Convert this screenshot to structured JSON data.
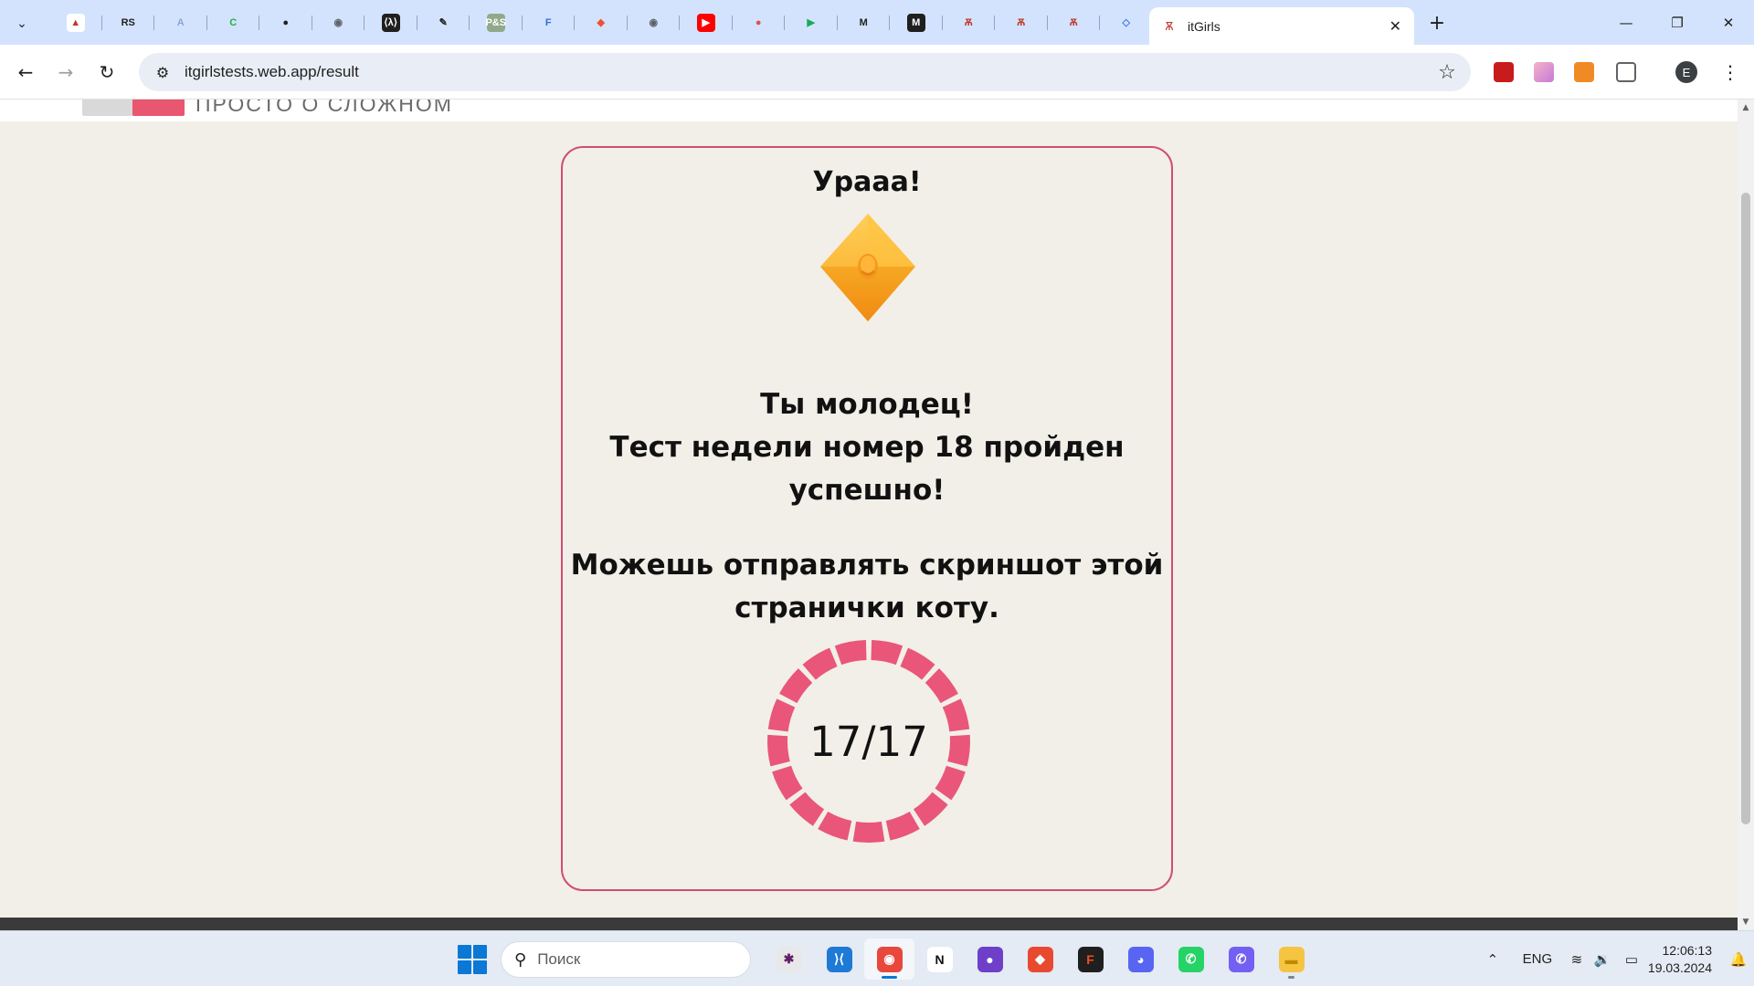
{
  "browser": {
    "tab_search_icon": "chevron-down-icon",
    "pinned_tabs": [
      {
        "icon": "pdf-reader-icon",
        "glyph": "▲",
        "bg": "#ffffff",
        "fg": "#c0392b"
      },
      {
        "icon": "rs-school-icon",
        "glyph": "RS",
        "bg": "transparent",
        "fg": "#1f1f1f"
      },
      {
        "icon": "a-letter-icon",
        "glyph": "A",
        "bg": "transparent",
        "fg": "#8aa6d6"
      },
      {
        "icon": "c-letter-icon",
        "glyph": "C",
        "bg": "transparent",
        "fg": "#1fb33a"
      },
      {
        "icon": "github-icon",
        "glyph": "●",
        "bg": "transparent",
        "fg": "#1f1f1f"
      },
      {
        "icon": "globe-icon",
        "glyph": "◉",
        "bg": "transparent",
        "fg": "#5f6368"
      },
      {
        "icon": "codewars-icon",
        "glyph": "⟨λ⟩",
        "bg": "#1f1f1f",
        "fg": "#ffffff"
      },
      {
        "icon": "pen-icon",
        "glyph": "✎",
        "bg": "transparent",
        "fg": "#1f1f1f"
      },
      {
        "icon": "pands-icon",
        "glyph": "P&S",
        "bg": "#8fa98a",
        "fg": "#ffffff"
      },
      {
        "icon": "docs-icon",
        "glyph": "F",
        "bg": "transparent",
        "fg": "#2f6fd6"
      },
      {
        "icon": "git-icon",
        "glyph": "◆",
        "bg": "transparent",
        "fg": "#f05033"
      },
      {
        "icon": "globe-icon",
        "glyph": "◉",
        "bg": "transparent",
        "fg": "#5f6368"
      },
      {
        "icon": "youtube-icon",
        "glyph": "▶",
        "bg": "#ff0000",
        "fg": "#ffffff"
      },
      {
        "icon": "pinterest-icon",
        "glyph": "●",
        "bg": "transparent",
        "fg": "#d9534f"
      },
      {
        "icon": "play-icon",
        "glyph": "▶",
        "bg": "transparent",
        "fg": "#19a95a"
      },
      {
        "icon": "mail-icon",
        "glyph": "M",
        "bg": "transparent",
        "fg": "#1f1f1f"
      },
      {
        "icon": "medium-icon",
        "glyph": "M",
        "bg": "#1f1f1f",
        "fg": "#ffffff"
      },
      {
        "icon": "itgirls-icon",
        "glyph": "Ѫ",
        "bg": "transparent",
        "fg": "#c0392b"
      },
      {
        "icon": "itgirls-icon",
        "glyph": "Ѫ",
        "bg": "transparent",
        "fg": "#c0392b"
      },
      {
        "icon": "itgirls-icon",
        "glyph": "Ѫ",
        "bg": "transparent",
        "fg": "#c0392b"
      },
      {
        "icon": "cube-icon",
        "glyph": "◇",
        "bg": "transparent",
        "fg": "#3a7bd5"
      }
    ],
    "active_tab": {
      "title": "itGirls",
      "icon": "itgirls-icon",
      "close_icon": "close-icon"
    },
    "new_tab_icon": "plus-icon",
    "window_controls": {
      "minimize": "—",
      "restore": "❐",
      "close": "✕"
    },
    "url": "itgirlstests.web.app/result",
    "avatar_letter": "E",
    "extensions": [
      {
        "icon": "acrobat-icon",
        "color": "#c81b1b"
      },
      {
        "icon": "gradient-extension-icon",
        "color": "#e68fb8"
      },
      {
        "icon": "orange-extension-icon",
        "color": "#f08a24"
      },
      {
        "icon": "puzzle-icon",
        "color": "#5f6368"
      }
    ]
  },
  "page": {
    "header_tagline": "ПРОСТО О СЛОЖНОМ",
    "card_title": "Урааа!",
    "message_line1": "Ты молодец!",
    "message_line2": "Тест недели номер 18 пройден",
    "message_line3": "успешно!",
    "screenshot_line1": "Можешь отправлять скриншот этой",
    "screenshot_line2": "странички коту.",
    "score_text": "17/17",
    "score": {
      "correct": 17,
      "total": 17
    },
    "accent_color": "#e9567a",
    "border_color": "#d14d72",
    "background_color": "#f2efe8"
  },
  "taskbar": {
    "search_placeholder": "Поиск",
    "apps": [
      {
        "name": "slack",
        "glyph": "✱",
        "bg": "#e8e8e8",
        "fg": "#611f69"
      },
      {
        "name": "vscode",
        "glyph": "⟩⟨",
        "bg": "#1f7ad6",
        "fg": "#ffffff"
      },
      {
        "name": "chrome",
        "glyph": "◉",
        "bg": "#e9473c",
        "fg": "#ffffff",
        "active": true
      },
      {
        "name": "notion",
        "glyph": "N",
        "bg": "#ffffff",
        "fg": "#111111"
      },
      {
        "name": "github-desktop",
        "glyph": "●",
        "bg": "#6e40c9",
        "fg": "#ffffff"
      },
      {
        "name": "git-tool",
        "glyph": "◆",
        "bg": "#e84a2f",
        "fg": "#ffffff"
      },
      {
        "name": "figma",
        "glyph": "F",
        "bg": "#1f1f1f",
        "fg": "#f24e1e"
      },
      {
        "name": "discord",
        "glyph": "◕",
        "bg": "#5865f2",
        "fg": "#ffffff"
      },
      {
        "name": "whatsapp",
        "glyph": "✆",
        "bg": "#25d366",
        "fg": "#ffffff"
      },
      {
        "name": "viber",
        "glyph": "✆",
        "bg": "#7360f2",
        "fg": "#ffffff"
      },
      {
        "name": "file-explorer",
        "glyph": "▬",
        "bg": "#f5c542",
        "fg": "#c08a00",
        "running": true
      }
    ],
    "tray": {
      "language": "ENG",
      "time": "12:06:13",
      "date": "19.03.2024"
    }
  }
}
